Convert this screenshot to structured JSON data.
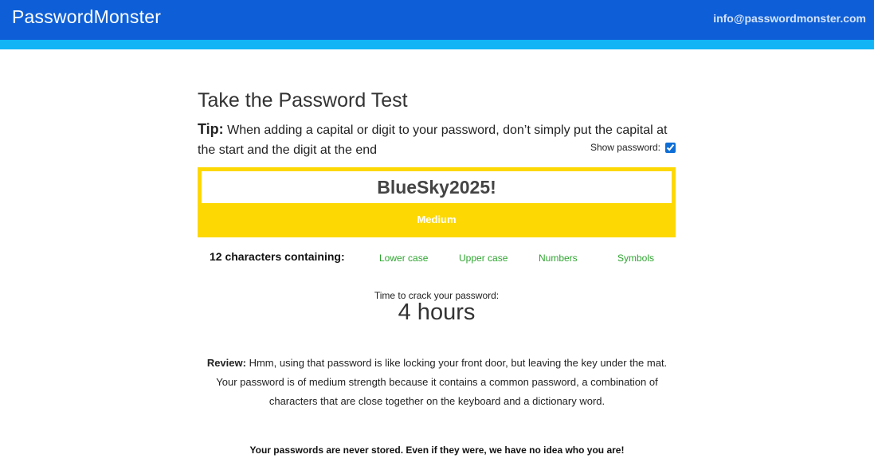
{
  "header": {
    "logo": "PasswordMonster",
    "contact_email": "info@passwordmonster.com"
  },
  "test": {
    "title": "Take the Password Test",
    "tip_label": "Tip:",
    "tip_text": "When adding a capital or digit to your password, don’t simply put the capital at the start and the digit at the end",
    "show_password_label": "Show password:",
    "show_password_checked": true,
    "password_value": "BlueSky2025!",
    "strength_label": "Medium",
    "strength_color": "#fdd803"
  },
  "characters": {
    "count_label": "12 characters containing:",
    "types": [
      "Lower case",
      "Upper case",
      "Numbers",
      "Symbols"
    ],
    "type_color": "#2fa531"
  },
  "crack": {
    "label": "Time to crack your password:",
    "time": "4 hours"
  },
  "review": {
    "label": "Review:",
    "text": "Hmm, using that password is like locking your front door, but leaving the key under the mat. Your password is of medium strength because it contains a common password, a combination of characters that are close together on the keyboard and a dictionary word."
  },
  "footer": {
    "note": "Your passwords are never stored. Even if they were, we have no idea who you are!"
  },
  "colors": {
    "header": "#0e5fd7",
    "stripe": "#12b4f5"
  }
}
